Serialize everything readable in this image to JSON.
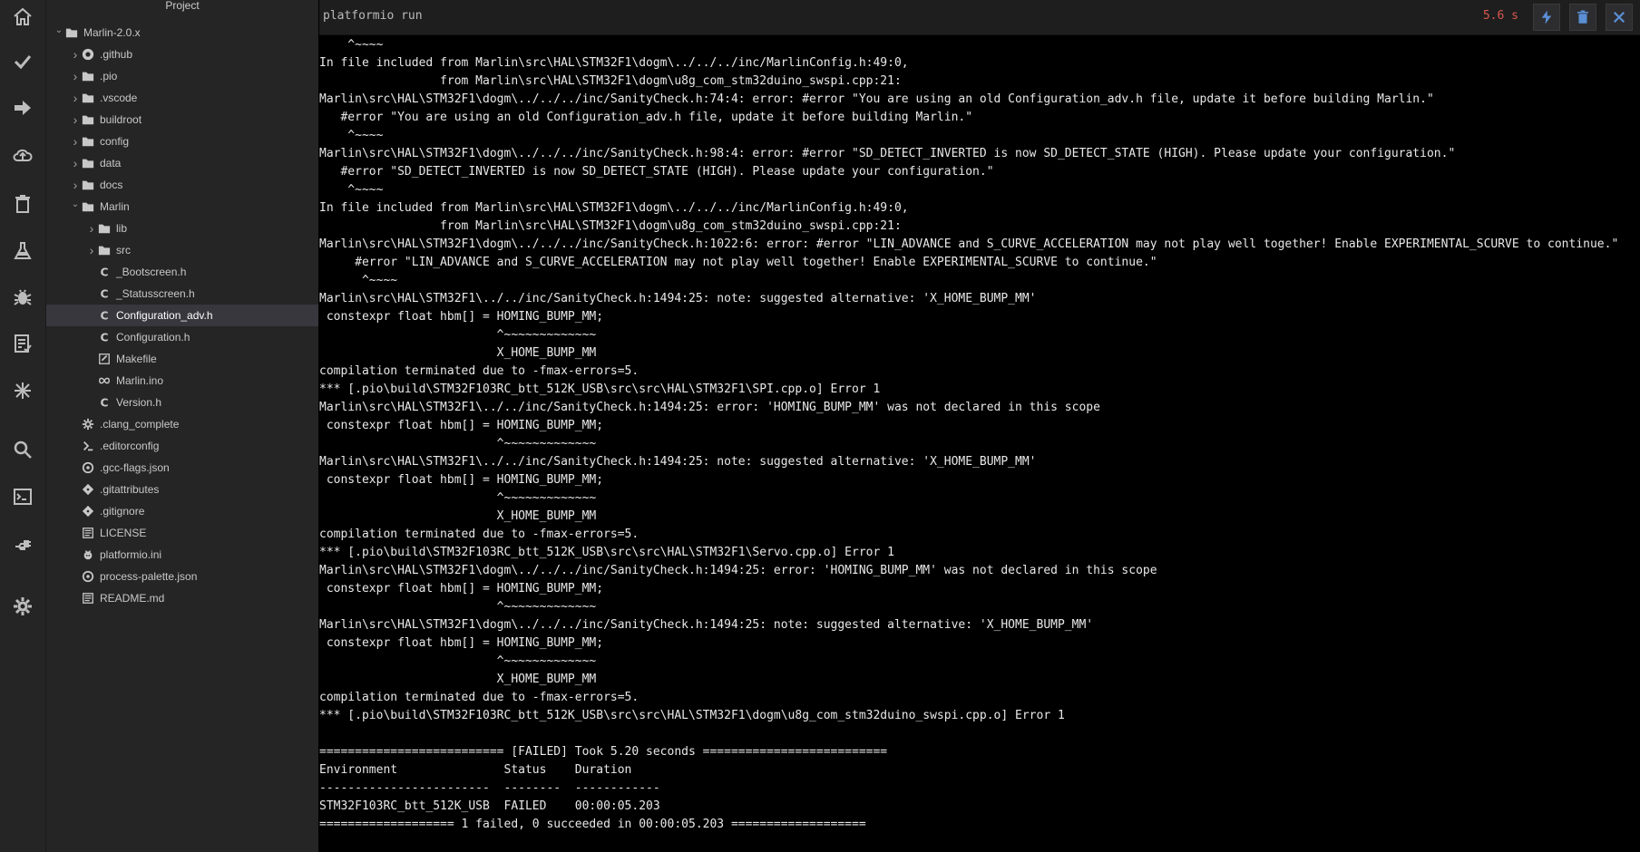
{
  "activity_bar": [
    {
      "name": "home-icon"
    },
    {
      "name": "check-icon"
    },
    {
      "name": "arrow-right-icon"
    },
    {
      "name": "cloud-upload-icon"
    },
    {
      "name": "trash-icon"
    },
    {
      "name": "flask-icon"
    },
    {
      "name": "bug-icon"
    },
    {
      "name": "checklist-icon"
    },
    {
      "name": "network-icon"
    },
    {
      "name": "search-icon"
    },
    {
      "name": "terminal-icon"
    },
    {
      "name": "plug-icon"
    },
    {
      "name": "gear-icon"
    }
  ],
  "sidebar": {
    "title": "Project",
    "tree": [
      {
        "label": "Marlin-2.0.x",
        "depth": 0,
        "chevron": "down",
        "icon": "folder-icon"
      },
      {
        "label": ".github",
        "depth": 1,
        "chevron": "right",
        "icon": "github-icon"
      },
      {
        "label": ".pio",
        "depth": 1,
        "chevron": "right",
        "icon": "folder-icon"
      },
      {
        "label": ".vscode",
        "depth": 1,
        "chevron": "right",
        "icon": "folder-icon"
      },
      {
        "label": "buildroot",
        "depth": 1,
        "chevron": "right",
        "icon": "folder-icon"
      },
      {
        "label": "config",
        "depth": 1,
        "chevron": "right",
        "icon": "folder-icon"
      },
      {
        "label": "data",
        "depth": 1,
        "chevron": "right",
        "icon": "folder-icon"
      },
      {
        "label": "docs",
        "depth": 1,
        "chevron": "right",
        "icon": "folder-icon"
      },
      {
        "label": "Marlin",
        "depth": 1,
        "chevron": "down",
        "icon": "folder-icon"
      },
      {
        "label": "lib",
        "depth": 2,
        "chevron": "right",
        "icon": "folder-icon"
      },
      {
        "label": "src",
        "depth": 2,
        "chevron": "right",
        "icon": "folder-icon"
      },
      {
        "label": "_Bootscreen.h",
        "depth": 2,
        "chevron": "",
        "icon": "c-file-icon"
      },
      {
        "label": "_Statusscreen.h",
        "depth": 2,
        "chevron": "",
        "icon": "c-file-icon"
      },
      {
        "label": "Configuration_adv.h",
        "depth": 2,
        "chevron": "",
        "icon": "c-file-icon",
        "selected": true
      },
      {
        "label": "Configuration.h",
        "depth": 2,
        "chevron": "",
        "icon": "c-file-icon"
      },
      {
        "label": "Makefile",
        "depth": 2,
        "chevron": "",
        "icon": "makefile-icon"
      },
      {
        "label": "Marlin.ino",
        "depth": 2,
        "chevron": "",
        "icon": "infinity-icon"
      },
      {
        "label": "Version.h",
        "depth": 2,
        "chevron": "",
        "icon": "c-file-icon"
      },
      {
        "label": ".clang_complete",
        "depth": 1,
        "chevron": "",
        "icon": "gear-file-icon"
      },
      {
        "label": ".editorconfig",
        "depth": 1,
        "chevron": "",
        "icon": "editorconfig-icon"
      },
      {
        "label": ".gcc-flags.json",
        "depth": 1,
        "chevron": "",
        "icon": "circle-file-icon"
      },
      {
        "label": ".gitattributes",
        "depth": 1,
        "chevron": "",
        "icon": "git-icon"
      },
      {
        "label": ".gitignore",
        "depth": 1,
        "chevron": "",
        "icon": "git-icon"
      },
      {
        "label": "LICENSE",
        "depth": 1,
        "chevron": "",
        "icon": "text-file-icon"
      },
      {
        "label": "platformio.ini",
        "depth": 1,
        "chevron": "",
        "icon": "platformio-icon"
      },
      {
        "label": "process-palette.json",
        "depth": 1,
        "chevron": "",
        "icon": "circle-file-icon"
      },
      {
        "label": "README.md",
        "depth": 1,
        "chevron": "",
        "icon": "text-file-icon"
      }
    ]
  },
  "terminal": {
    "title": "platformio run",
    "elapsed": "5.6 s",
    "buttons": [
      {
        "name": "run-bolt-button",
        "icon": "bolt-icon"
      },
      {
        "name": "clear-trash-button",
        "icon": "trash-icon"
      },
      {
        "name": "close-terminal-button",
        "icon": "close-icon"
      }
    ],
    "lines": [
      "    ^~~~~",
      "In file included from Marlin\\src\\HAL\\STM32F1\\dogm\\../../../inc/MarlinConfig.h:49:0,",
      "                 from Marlin\\src\\HAL\\STM32F1\\dogm\\u8g_com_stm32duino_swspi.cpp:21:",
      "Marlin\\src\\HAL\\STM32F1\\dogm\\../../../inc/SanityCheck.h:74:4: error: #error \"You are using an old Configuration_adv.h file, update it before building Marlin.\"",
      "   #error \"You are using an old Configuration_adv.h file, update it before building Marlin.\"",
      "    ^~~~~",
      "Marlin\\src\\HAL\\STM32F1\\dogm\\../../../inc/SanityCheck.h:98:4: error: #error \"SD_DETECT_INVERTED is now SD_DETECT_STATE (HIGH). Please update your configuration.\"",
      "   #error \"SD_DETECT_INVERTED is now SD_DETECT_STATE (HIGH). Please update your configuration.\"",
      "    ^~~~~",
      "In file included from Marlin\\src\\HAL\\STM32F1\\dogm\\../../../inc/MarlinConfig.h:49:0,",
      "                 from Marlin\\src\\HAL\\STM32F1\\dogm\\u8g_com_stm32duino_swspi.cpp:21:",
      "Marlin\\src\\HAL\\STM32F1\\dogm\\../../../inc/SanityCheck.h:1022:6: error: #error \"LIN_ADVANCE and S_CURVE_ACCELERATION may not play well together! Enable EXPERIMENTAL_SCURVE to continue.\"",
      "     #error \"LIN_ADVANCE and S_CURVE_ACCELERATION may not play well together! Enable EXPERIMENTAL_SCURVE to continue.\"",
      "      ^~~~~",
      "Marlin\\src\\HAL\\STM32F1\\../../inc/SanityCheck.h:1494:25: note: suggested alternative: 'X_HOME_BUMP_MM'",
      " constexpr float hbm[] = HOMING_BUMP_MM;",
      "                         ^~~~~~~~~~~~~~",
      "                         X_HOME_BUMP_MM",
      "compilation terminated due to -fmax-errors=5.",
      "*** [.pio\\build\\STM32F103RC_btt_512K_USB\\src\\src\\HAL\\STM32F1\\SPI.cpp.o] Error 1",
      "Marlin\\src\\HAL\\STM32F1\\../../inc/SanityCheck.h:1494:25: error: 'HOMING_BUMP_MM' was not declared in this scope",
      " constexpr float hbm[] = HOMING_BUMP_MM;",
      "                         ^~~~~~~~~~~~~~",
      "Marlin\\src\\HAL\\STM32F1\\../../inc/SanityCheck.h:1494:25: note: suggested alternative: 'X_HOME_BUMP_MM'",
      " constexpr float hbm[] = HOMING_BUMP_MM;",
      "                         ^~~~~~~~~~~~~~",
      "                         X_HOME_BUMP_MM",
      "compilation terminated due to -fmax-errors=5.",
      "*** [.pio\\build\\STM32F103RC_btt_512K_USB\\src\\src\\HAL\\STM32F1\\Servo.cpp.o] Error 1",
      "Marlin\\src\\HAL\\STM32F1\\dogm\\../../../inc/SanityCheck.h:1494:25: error: 'HOMING_BUMP_MM' was not declared in this scope",
      " constexpr float hbm[] = HOMING_BUMP_MM;",
      "                         ^~~~~~~~~~~~~~",
      "Marlin\\src\\HAL\\STM32F1\\dogm\\../../../inc/SanityCheck.h:1494:25: note: suggested alternative: 'X_HOME_BUMP_MM'",
      " constexpr float hbm[] = HOMING_BUMP_MM;",
      "                         ^~~~~~~~~~~~~~",
      "                         X_HOME_BUMP_MM",
      "compilation terminated due to -fmax-errors=5.",
      "*** [.pio\\build\\STM32F103RC_btt_512K_USB\\src\\src\\HAL\\STM32F1\\dogm\\u8g_com_stm32duino_swspi.cpp.o] Error 1",
      "",
      "========================== [FAILED] Took 5.20 seconds ==========================",
      "Environment               Status    Duration",
      "------------------------  --------  ------------",
      "STM32F103RC_btt_512K_USB  FAILED    00:00:05.203",
      "=================== 1 failed, 0 succeeded in 00:00:05.203 ==================="
    ]
  },
  "colors": {
    "sidebar_bg": "#252526",
    "terminal_bg": "#000000",
    "accent_error": "#d8584f",
    "icon_gray": "#bdbdbd"
  }
}
